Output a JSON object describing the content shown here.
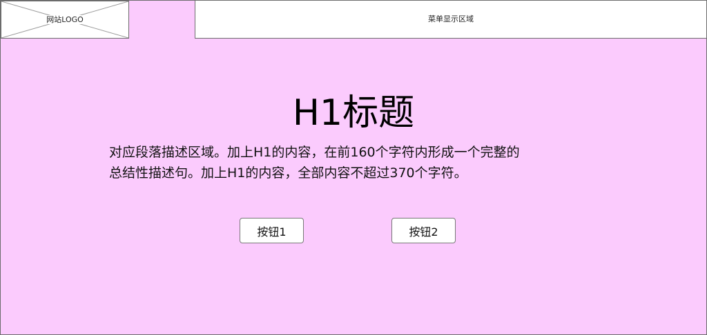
{
  "header": {
    "logo_placeholder": "网站LOGO",
    "menu_area_label": "菜单显示区域"
  },
  "hero": {
    "title": "H1标题",
    "description_line1": "对应段落描述区域。加上H1的内容，在前160个字符内形成一个完整的",
    "description_line2": "总结性描述句。加上H1的内容，全部内容不超过370个字符。"
  },
  "buttons": [
    {
      "label": "按钮1"
    },
    {
      "label": "按钮2"
    }
  ],
  "colors": {
    "page_background": "#fbcbfd",
    "header_background": "#ffffff",
    "border": "#6b6b6b",
    "text": "#000000"
  }
}
